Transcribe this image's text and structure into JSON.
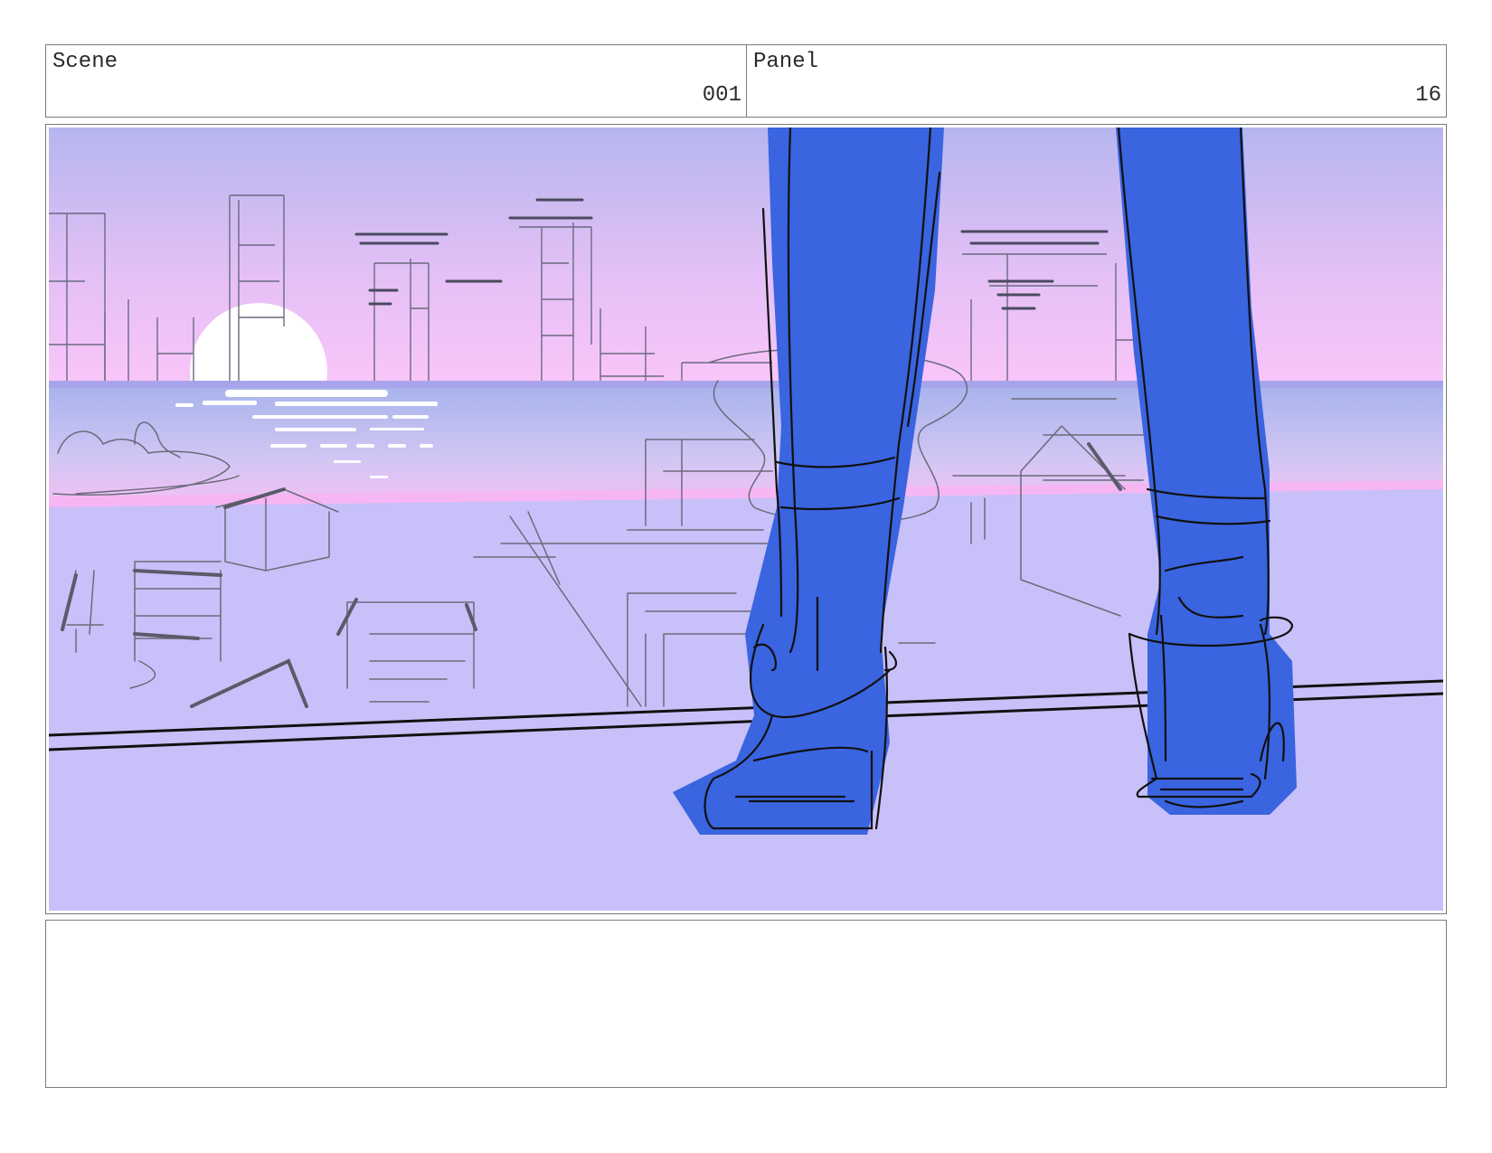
{
  "header": {
    "scene_label": "Scene",
    "scene_value": "001",
    "panel_label": "Panel",
    "panel_value": "16"
  },
  "notes": {
    "text": ""
  },
  "colors": {
    "sky_top": "#b8b8f0",
    "sky_bottom": "#fcc4f8",
    "water": "#b0b8ec",
    "ground": "#c8c0f8",
    "legs": "#3a64e0",
    "ink": "#111111",
    "pencil": "#5a5a6a"
  }
}
